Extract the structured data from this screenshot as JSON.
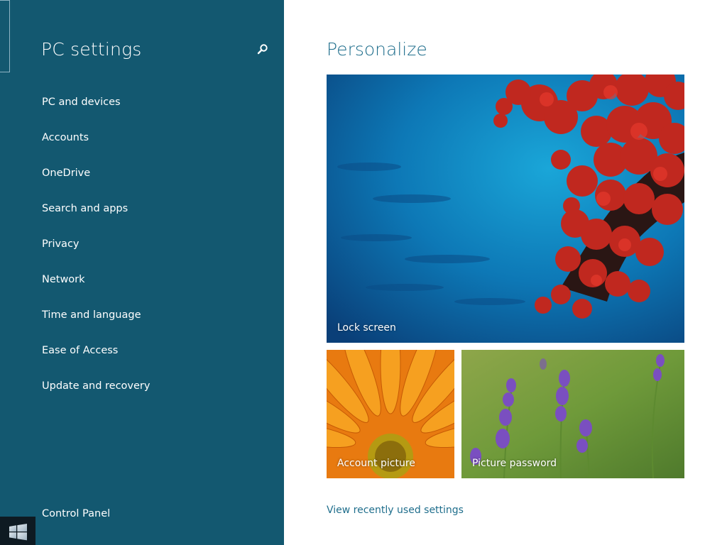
{
  "sidebar": {
    "title": "PC settings",
    "search_icon": "search-icon",
    "items": [
      {
        "label": "PC and devices"
      },
      {
        "label": "Accounts"
      },
      {
        "label": "OneDrive"
      },
      {
        "label": "Search and apps"
      },
      {
        "label": "Privacy"
      },
      {
        "label": "Network"
      },
      {
        "label": "Time and language"
      },
      {
        "label": "Ease of Access"
      },
      {
        "label": "Update and recovery"
      }
    ],
    "control_panel": "Control Panel"
  },
  "main": {
    "title": "Personalize",
    "tiles": {
      "lock_screen": "Lock screen",
      "account_picture": "Account picture",
      "picture_password": "Picture password"
    },
    "recent_link": "View recently used settings"
  },
  "taskbar": {
    "start_icon": "windows-logo-icon"
  },
  "colors": {
    "sidebar_bg": "#135870",
    "accent": "#1f6e8c",
    "background": "#ffffff"
  }
}
